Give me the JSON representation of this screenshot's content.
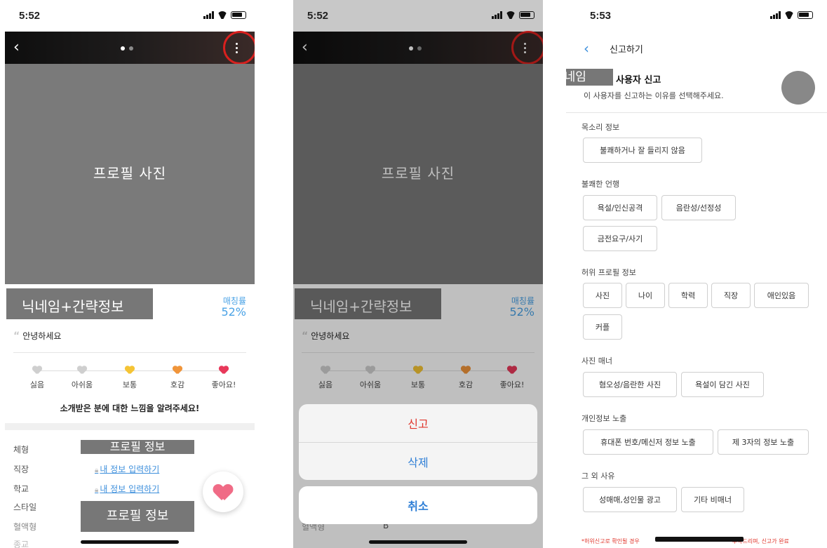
{
  "status": {
    "time1": "5:52",
    "time2": "5:52",
    "time3": "5:53"
  },
  "profile": {
    "photo_label": "프로필 사진",
    "nickname_block": "닉네임+간략정보",
    "match_label": "매칭률",
    "match_value": "52%",
    "greeting": "안녕하세요",
    "ratings": [
      {
        "label": "싫음",
        "color": "#cfcfcf"
      },
      {
        "label": "아쉬움",
        "color": "#cfcfcf"
      },
      {
        "label": "보통",
        "color": "#f5c435"
      },
      {
        "label": "호감",
        "color": "#f0953a"
      },
      {
        "label": "좋아요!",
        "color": "#e8385a"
      }
    ],
    "feel_caption": "소개받은 분에 대한 느낌을 알려주세요!",
    "info_labels": [
      "체형",
      "직장",
      "학교",
      "스타일",
      "혈액형",
      "종교"
    ],
    "info_link": "내 정보 입력하기",
    "profile_info_box": "프로필 정보",
    "blood_value": "B",
    "fab_color": "#f06b86"
  },
  "action_sheet": {
    "report": "신고",
    "delete": "삭제",
    "cancel": "취소"
  },
  "report_page": {
    "title": "신고하기",
    "nickname": "닉네임",
    "user_report": "사용자 신고",
    "subtitle": "이 사용자를 신고하는 이유를 선택해주세요.",
    "sections": [
      {
        "label": "목소리 정보",
        "chips": [
          "불쾌하거나 잘 들리지 않음"
        ]
      },
      {
        "label": "불쾌한 언행",
        "chips": [
          "욕설/인신공격",
          "음란성/선정성",
          "금전요구/사기"
        ]
      },
      {
        "label": "허위 프로필 정보",
        "chips": [
          "사진",
          "나이",
          "학력",
          "직장",
          "애인있음",
          "커플"
        ]
      },
      {
        "label": "사진 매너",
        "chips": [
          "혐오성/음란한 사진",
          "욕설이 담긴 사진"
        ]
      },
      {
        "label": "개인정보 노출",
        "chips": [
          "휴대폰 번호/메신저 정보 노출",
          "제 3자의 정보 노출"
        ]
      },
      {
        "label": "그 외 사유",
        "chips": [
          "성매매,성인물 광고",
          "기타 비매너"
        ]
      }
    ],
    "footnote_start": "*허위신고로 확인될 경우",
    "footnote_end": "부탁드리며, 신고가 완료"
  }
}
